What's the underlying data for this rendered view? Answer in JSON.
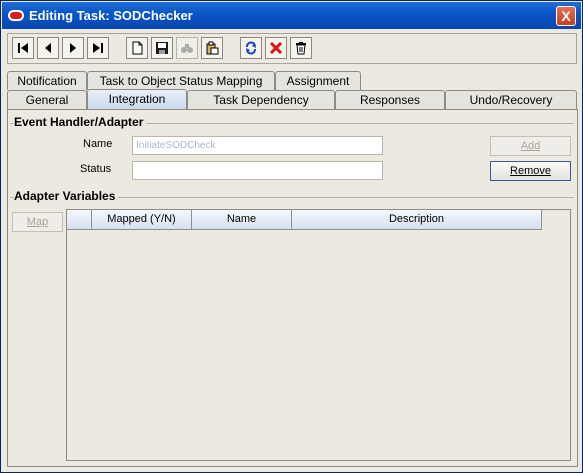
{
  "window": {
    "title": "Editing Task: SODChecker",
    "close_glyph": "X"
  },
  "toolbar": {
    "buttons": [
      {
        "name": "first-record-icon"
      },
      {
        "name": "previous-record-icon"
      },
      {
        "name": "next-record-icon"
      },
      {
        "name": "last-record-icon"
      },
      {
        "name": "new-document-icon"
      },
      {
        "name": "save-icon"
      },
      {
        "name": "find-icon"
      },
      {
        "name": "paste-icon"
      },
      {
        "name": "refresh-icon"
      },
      {
        "name": "delete-icon"
      },
      {
        "name": "trash-icon"
      }
    ]
  },
  "tabs_row1": [
    "Notification",
    "Task to Object Status Mapping",
    "Assignment"
  ],
  "tabs_row2": [
    "General",
    "Integration",
    "Task Dependency",
    "Responses",
    "Undo/Recovery"
  ],
  "active_tab": "Integration",
  "event_handler": {
    "title": "Event Handler/Adapter",
    "name_label": "Name",
    "name_value": "InitiateSODCheck",
    "status_label": "Status",
    "status_value": "",
    "add_label": "Add",
    "remove_label": "Remove"
  },
  "adapter_variables": {
    "title": "Adapter Variables",
    "map_label": "Map",
    "columns": [
      "Mapped (Y/N)",
      "Name",
      "Description"
    ],
    "rows": []
  },
  "colors": {
    "titlebar": "#0a56c8",
    "background": "#ece9e1",
    "delete": "#e01010"
  }
}
